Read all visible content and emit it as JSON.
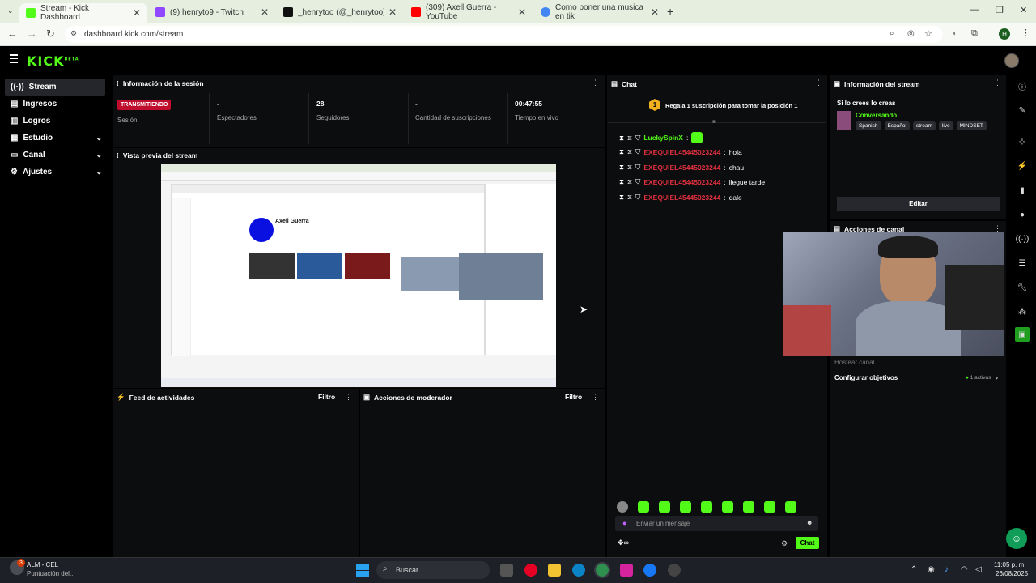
{
  "browser": {
    "tabs": [
      {
        "label": "Stream - Kick Dashboard",
        "active": true,
        "icon": "kick-icon"
      },
      {
        "label": "(9) henryto9 - Twitch",
        "icon": "twitch-icon"
      },
      {
        "label": "_henrytoo (@_henrytoo) está en",
        "icon": "tiktok-icon"
      },
      {
        "label": "(309) Axell Guerra - YouTube",
        "icon": "youtube-icon"
      },
      {
        "label": "Como poner una musica en tik",
        "icon": "google-icon"
      }
    ],
    "url": "dashboard.kick.com/stream",
    "profile_initial": "H"
  },
  "kick": {
    "logo": "KICK",
    "beta": "BETA"
  },
  "sidebar": {
    "items": [
      {
        "label": "Stream",
        "icon": "live-icon"
      },
      {
        "label": "Ingresos",
        "icon": "wallet-icon"
      },
      {
        "label": "Logros",
        "icon": "trophy-icon"
      },
      {
        "label": "Estudio",
        "icon": "studio-icon"
      },
      {
        "label": "Canal",
        "icon": "channel-icon"
      },
      {
        "label": "Ajustes",
        "icon": "gear-icon"
      }
    ]
  },
  "session": {
    "title": "Información de la sesión",
    "status": "TRANSMITIENDO",
    "session_label": "Sesión",
    "stats": [
      {
        "value": "-",
        "label": "Espectadores"
      },
      {
        "value": "28",
        "label": "Seguidores"
      },
      {
        "value": "-",
        "label": "Cantidad de suscripciones"
      },
      {
        "value": "00:47:55",
        "label": "Tiempo en vivo"
      }
    ]
  },
  "preview": {
    "title": "Vista previa del stream",
    "channel_name": "Axell Guerra"
  },
  "feed": {
    "title": "Feed de actividades",
    "filter": "Filtro"
  },
  "moderator": {
    "title": "Acciones de moderador",
    "filter": "Filtro"
  },
  "chat": {
    "title": "Chat",
    "gift_rank": "1",
    "gift_text": "Regala 1 suscripción para tomar la posición 1",
    "messages": [
      {
        "user": "LuckySpinX",
        "text": "",
        "color": "#53fc18"
      },
      {
        "user": "EXEQUIEL45445023244",
        "text": "hola",
        "color": "#e1303e"
      },
      {
        "user": "EXEQUIEL45445023244",
        "text": "chau",
        "color": "#e1303e"
      },
      {
        "user": "EXEQUIEL45445023244",
        "text": "llegue tarde",
        "color": "#e1303e"
      },
      {
        "user": "EXEQUIEL45445023244",
        "text": "dale",
        "color": "#e1303e"
      }
    ],
    "placeholder": "Enviar un mensaje",
    "send_label": "Chat"
  },
  "stream_info": {
    "title": "Información del stream",
    "stream_title": "Si lo crees lo creas",
    "category": "Conversando",
    "tags": [
      "Spanish",
      "Español",
      "stream",
      "live",
      "MINDSET"
    ],
    "edit_label": "Editar"
  },
  "channel_actions": {
    "title": "Acciones de canal",
    "host_label": "Hostear canal",
    "goals_label": "Configurar objetivos",
    "goals_count": "1 activas"
  },
  "taskbar": {
    "notif_count": "3",
    "notif_title": "ALM - CEL",
    "notif_sub": "Puntuación del...",
    "search": "Buscar",
    "time": "11:05 p. m.",
    "date": "26/08/2025"
  },
  "colors": {
    "kick_green": "#53fc18",
    "live_red": "#c00d2d",
    "mod_red": "#e1303e"
  }
}
